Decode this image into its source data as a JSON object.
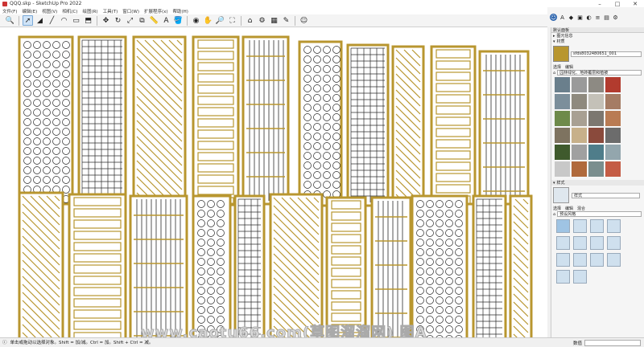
{
  "window": {
    "title": "QQQ.skp - SketchUp Pro 2022"
  },
  "menu": [
    "文件(F)",
    "编辑(E)",
    "视图(V)",
    "相机(C)",
    "绘图(R)",
    "工具(T)",
    "窗口(W)",
    "扩展程序(x)",
    "帮助(H)"
  ],
  "tray": {
    "title": "默认面板",
    "entity_info": "图元信息",
    "materials": "材质",
    "material_name": "sfds8032480651_001",
    "tab_select": "选择",
    "tab_edit": "编辑",
    "library": "园林绿化、地砖覆层和植被",
    "styles_header": "样式",
    "style_name": "样式",
    "style_tab_mix": "混合",
    "style_library": "预设风格",
    "swatch_colors": [
      "#6a7f8c",
      "#9a9a9a",
      "#8d8a83",
      "#b23b2e",
      "#7c8f9b",
      "#8f8a7e",
      "#c4c1b8",
      "#a57c64",
      "#6e8a4a",
      "#a8a093",
      "#7c7770",
      "#b97b53",
      "#7e7360",
      "#c7b08a",
      "#8a4a3c",
      "#6c6c6c",
      "#3f5a2d",
      "#a0a0a0",
      "#4f7d8a",
      "#93a6ad",
      "#c8c8c8",
      "#b06a3c",
      "#7a8e8e",
      "#c45c45"
    ]
  },
  "status": {
    "hint": "单击或拖动以选择对象。Shift = 加/减。Ctrl = 加。Shift + Ctrl = 减。",
    "measure_label": "数值"
  },
  "watermark": "www.caotu66.com(草图溜溜网) 图A",
  "panels": {
    "frame_color": "#b8962f",
    "line_color": "#2b2b2b"
  }
}
